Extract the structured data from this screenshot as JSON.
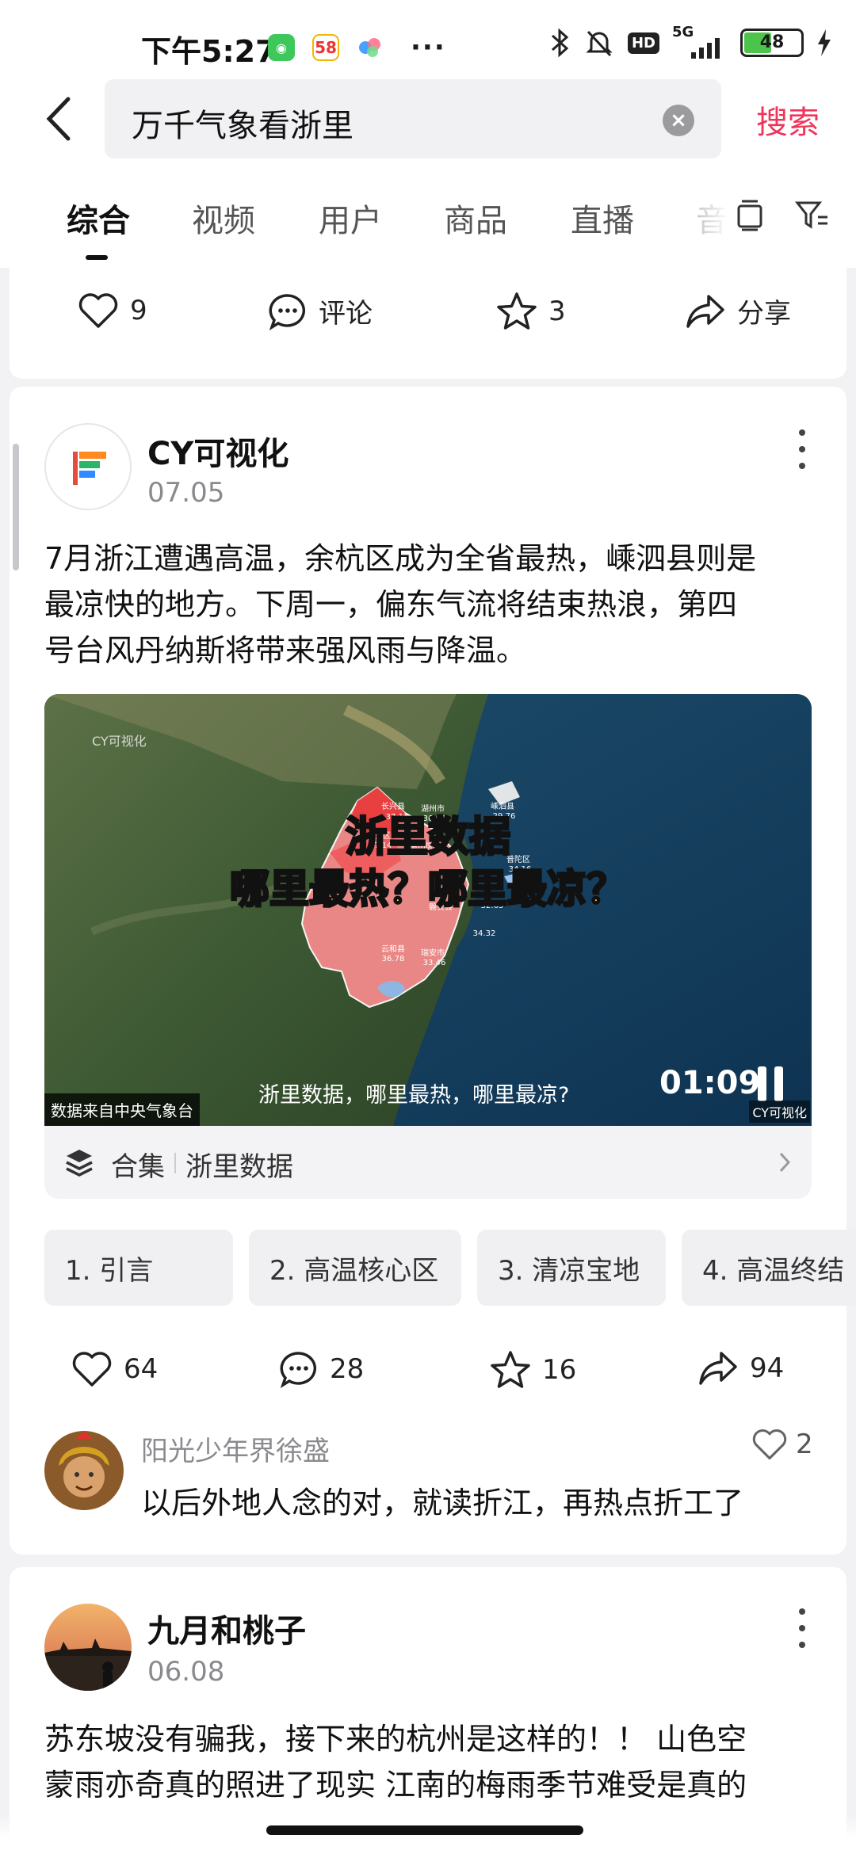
{
  "status_bar": {
    "time": "下午5:27",
    "app_badges": [
      "58"
    ],
    "more": "···",
    "network": "5G",
    "hd": "HD",
    "battery": "48"
  },
  "search": {
    "query": "万千气象看浙里",
    "clear_icon": "clear-icon",
    "button_label": "搜索"
  },
  "tabs": {
    "items": [
      "综合",
      "视频",
      "用户",
      "商品",
      "直播",
      "音"
    ],
    "active_index": 0
  },
  "previous_post": {
    "likes": "9",
    "comment_label": "评论",
    "favorites": "3",
    "share_label": "分享"
  },
  "post": {
    "author": "CY可视化",
    "date": "07.05",
    "text_lines": [
      "7月浙江遭遇高温，余杭区成为全省最热，嵊泗县则是",
      "最凉快的地方。下周一，偏东气流将结束热浪，第四",
      "号台风丹纳斯将带来强风雨与降温。"
    ],
    "video": {
      "watermark": "CY可视化",
      "title_line1": "浙里数据",
      "title_line2": "哪里最热？哪里最凉？",
      "map_labels": [
        "长兴县",
        "37.14",
        "湖州市",
        "36.62",
        "嵊泗县",
        "29.76",
        "临安区",
        "37.14",
        "萧山区",
        "普陀区",
        "34.16",
        "磐安县",
        "32.65",
        "云和县",
        "36.78",
        "瑞安市",
        "33.46",
        "34.32"
      ],
      "source": "数据来自中央气象台",
      "subtitle": "浙里数据，哪里最热，哪里最凉?",
      "duration": "01:09",
      "corner_mark": "CY可视化"
    },
    "collection": {
      "label": "合集",
      "name": "浙里数据"
    },
    "chapters": [
      "1. 引言",
      "2. 高温核心区",
      "3. 清凉宝地",
      "4. 高温终结"
    ],
    "stats": {
      "likes": "64",
      "comments": "28",
      "favorites": "16",
      "shares": "94"
    },
    "top_comment": {
      "user": "阳光少年界徐盛",
      "text": "以后外地人念的对，就读折江，再热点折工了",
      "likes": "2"
    }
  },
  "next_post": {
    "author": "九月和桃子",
    "date": "06.08",
    "text_lines": [
      "苏东坡没有骗我，接下来的杭州是这样的！！ 山色空",
      "蒙雨亦奇真的照进了现实 江南的梅雨季节难受是真的"
    ]
  }
}
